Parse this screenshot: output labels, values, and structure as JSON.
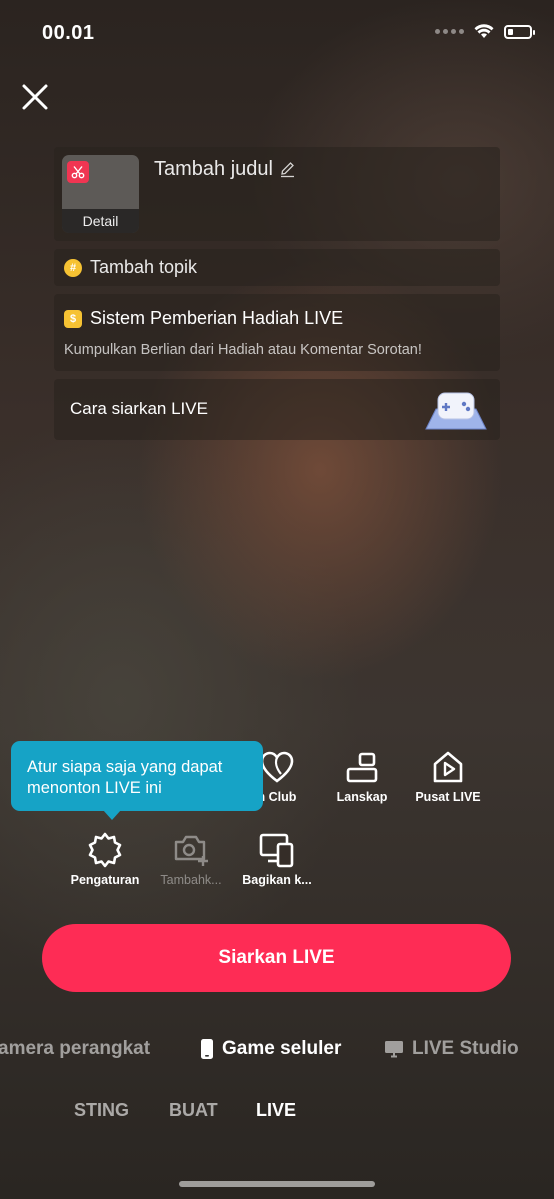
{
  "status_bar": {
    "time": "00.01"
  },
  "title_card": {
    "thumbnail_label": "Detail",
    "title_placeholder": "Tambah judul"
  },
  "topic": {
    "label": "Tambah topik"
  },
  "gift": {
    "title": "Sistem Pemberian Hadiah LIVE",
    "subtitle": "Kumpulkan Berlian dari Hadiah atau Komentar Sorotan!"
  },
  "howto": {
    "label": "Cara siarkan LIVE"
  },
  "tooltip": {
    "text_line1": "Atur siapa saja yang dapat",
    "text_line2": "menonton LIVE ini"
  },
  "tools": {
    "fan_club": "n Club",
    "landscape": "Lanskap",
    "live_center": "Pusat LIVE",
    "settings": "Pengaturan",
    "add_photo": "Tambahk...",
    "share": "Bagikan k..."
  },
  "go_live_label": "Siarkan LIVE",
  "modes": {
    "device_camera": "amera perangkat",
    "mobile_game": "Game seluler",
    "live_studio": "LIVE Studio"
  },
  "tabs": {
    "posting": "STING",
    "create": "BUAT",
    "live": "LIVE"
  },
  "colors": {
    "accent": "#fe2c55",
    "tooltip": "#16a3c6",
    "coin": "#f6c233"
  }
}
